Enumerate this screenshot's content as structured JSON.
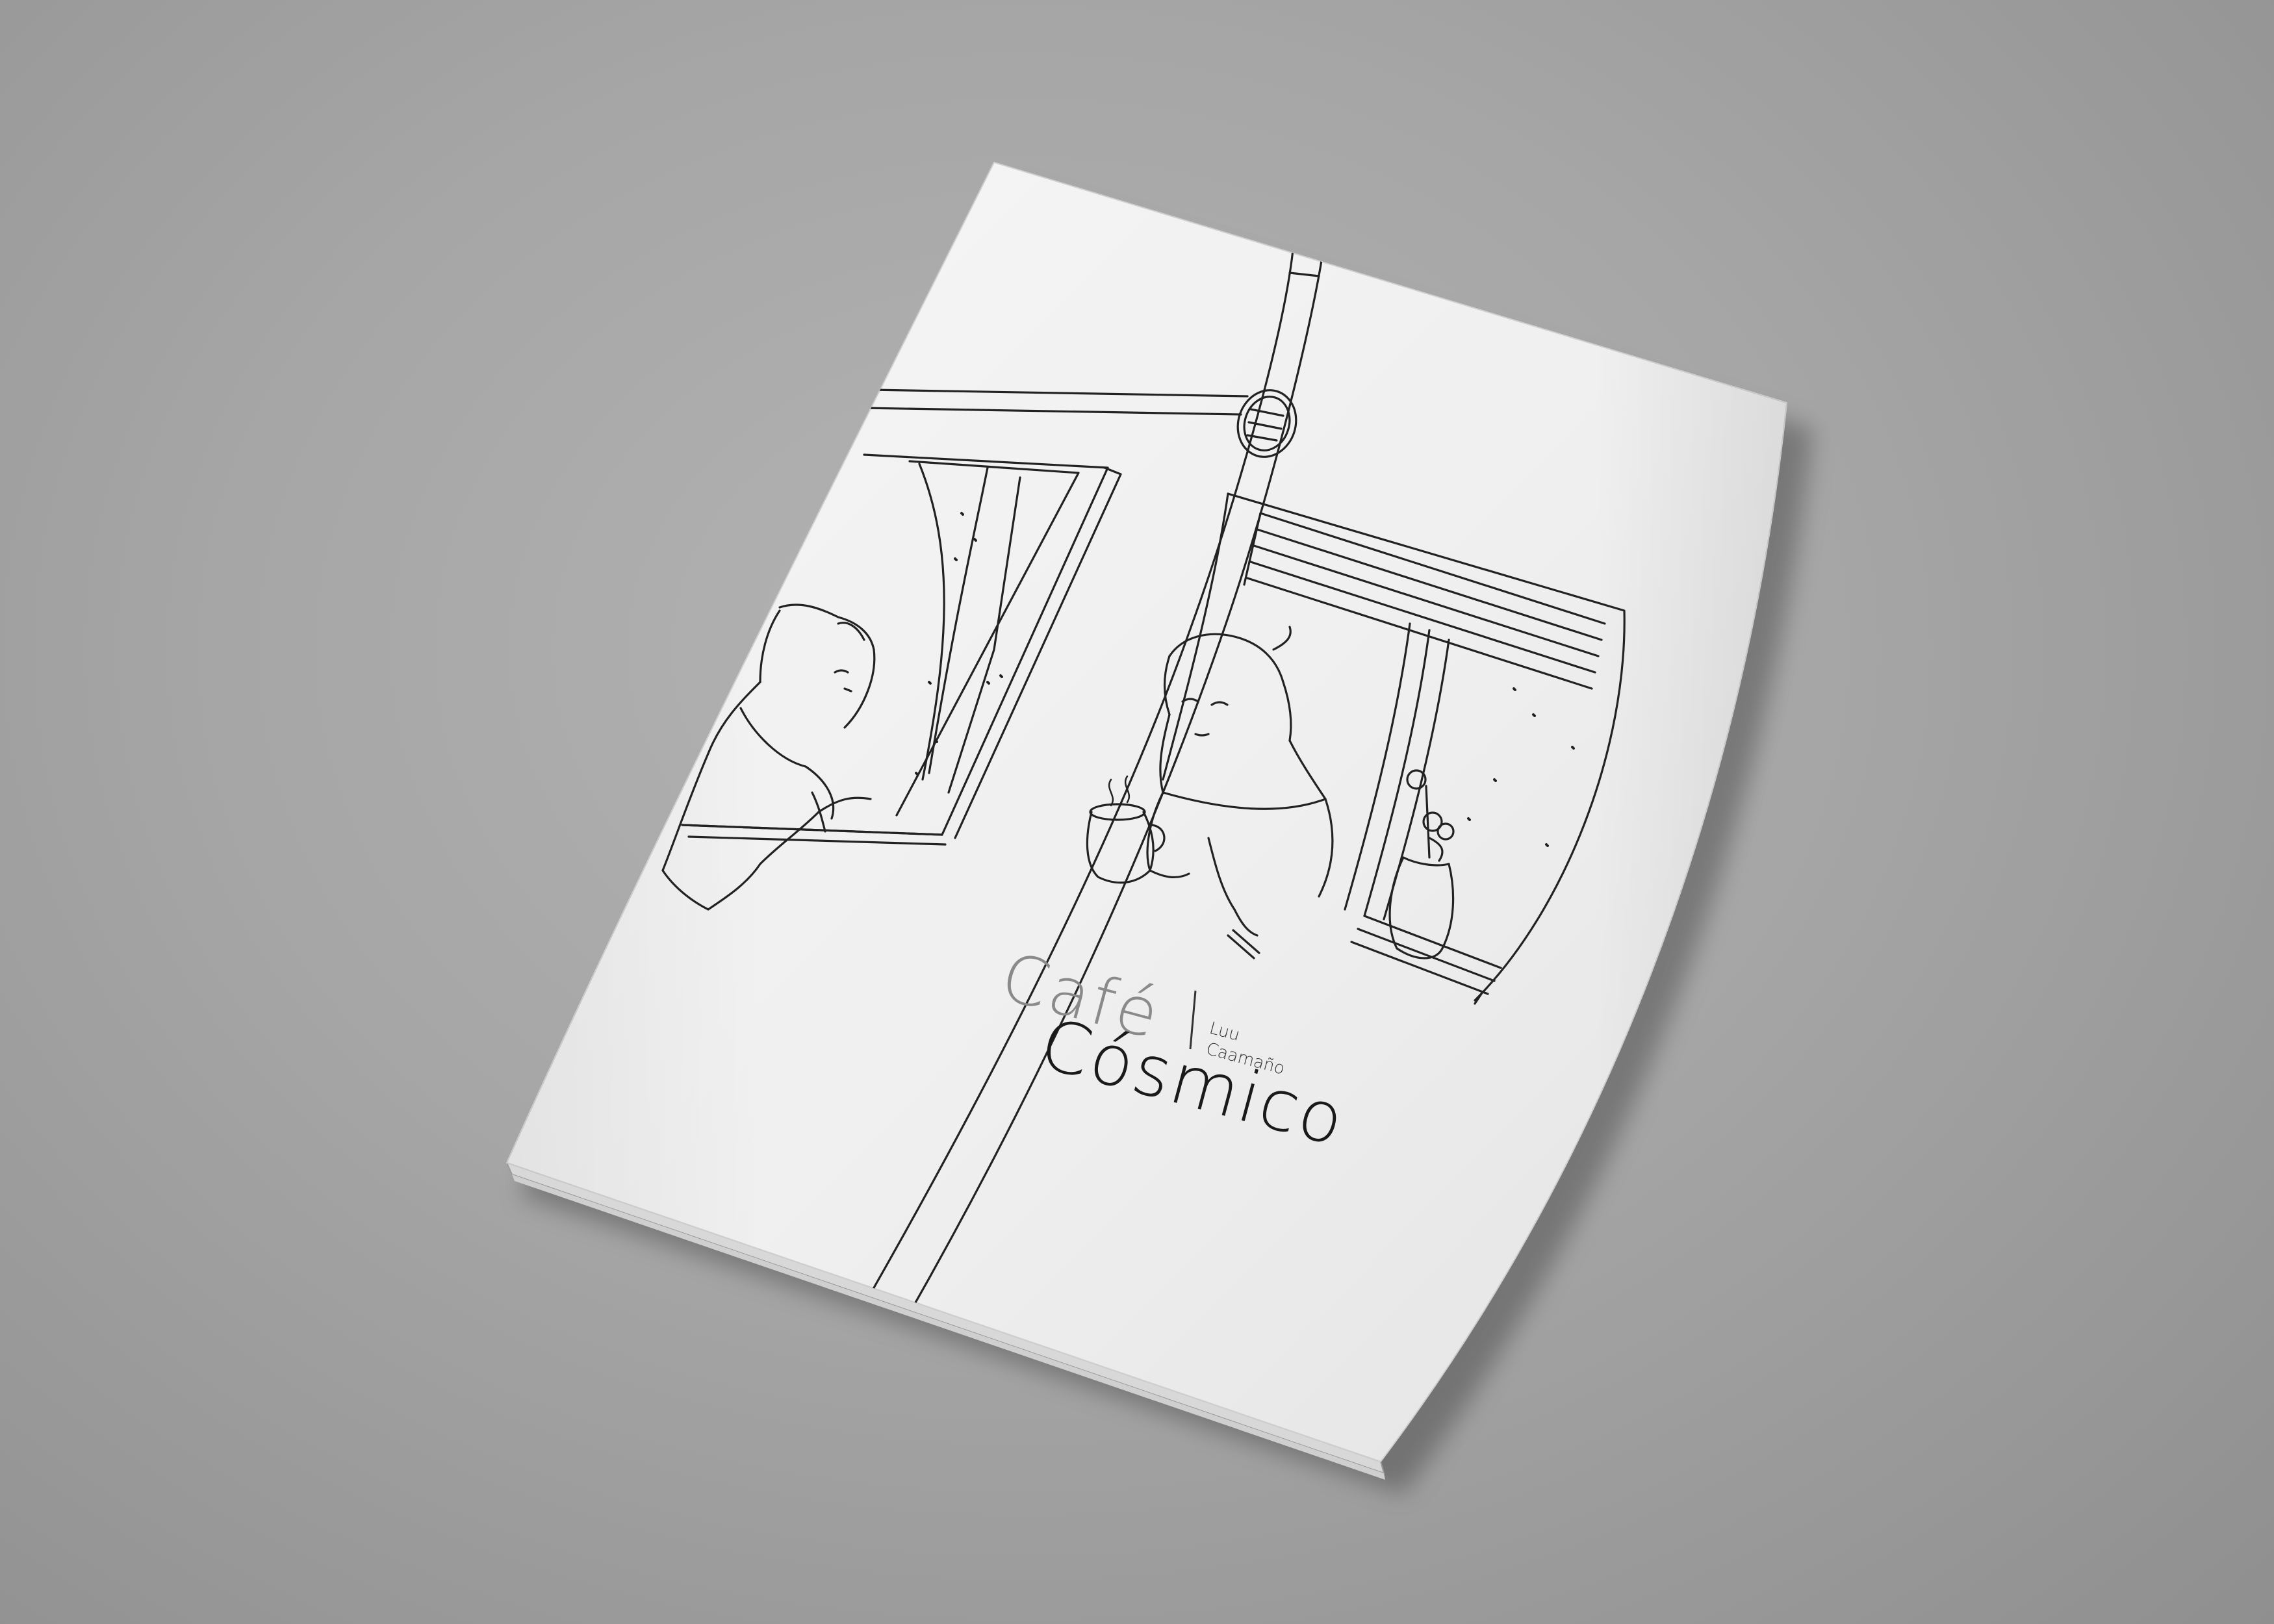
{
  "booklet": {
    "title_line1": "Café",
    "title_line2": "Cósmico",
    "author_line1": "Luu",
    "author_line2": "Caamaño"
  },
  "colors": {
    "background": "#a6a6a6",
    "paper": "#f1f1f1",
    "ink": "#222222",
    "title_light": "#8a8a8a",
    "title_dark": "#1a1a1a"
  },
  "illustration": {
    "description_icons": [
      "left-window-icon",
      "right-window-icon",
      "clock-icon",
      "coffee-mug-icon",
      "flower-pot-icon"
    ]
  }
}
